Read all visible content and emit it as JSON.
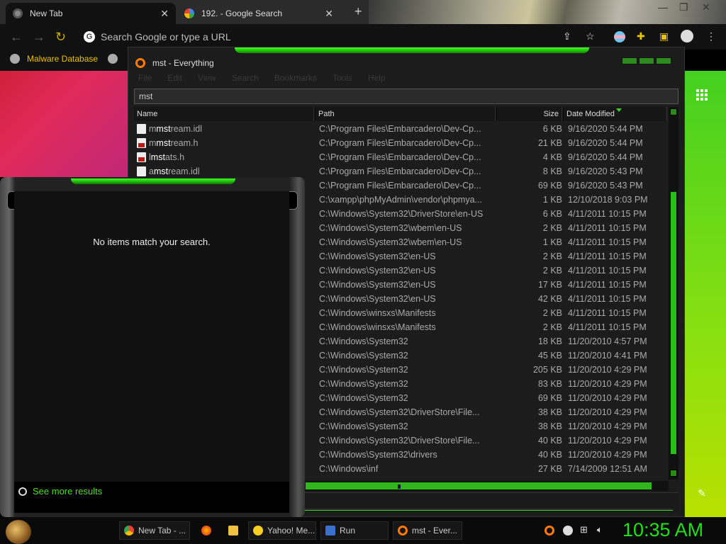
{
  "browser": {
    "tabs": [
      {
        "title": "New Tab",
        "active": true
      },
      {
        "title": "192. - Google Search",
        "active": false
      }
    ],
    "omnibox_placeholder": "Search Google or type a URL",
    "bookmark": "Malware Database"
  },
  "everything": {
    "title": "mst - Everything",
    "menu": [
      "File",
      "Edit",
      "View",
      "Search",
      "Bookmarks",
      "Tools",
      "Help"
    ],
    "search_value": "mst",
    "columns": {
      "name": "Name",
      "path": "Path",
      "size": "Size",
      "date": "Date Modified"
    },
    "rows": [
      {
        "pre": "m",
        "hit": "mst",
        "post": "ream.idl",
        "icon": "file",
        "path": "C:\\Program Files\\Embarcadero\\Dev-Cp...",
        "size": "6 KB",
        "date": "9/16/2020 5:44 PM"
      },
      {
        "pre": "m",
        "hit": "mst",
        "post": "ream.h",
        "icon": "red",
        "path": "C:\\Program Files\\Embarcadero\\Dev-Cp...",
        "size": "21 KB",
        "date": "9/16/2020 5:44 PM"
      },
      {
        "pre": "l",
        "hit": "mst",
        "post": "ats.h",
        "icon": "red",
        "path": "C:\\Program Files\\Embarcadero\\Dev-Cp...",
        "size": "4 KB",
        "date": "9/16/2020 5:44 PM"
      },
      {
        "pre": "a",
        "hit": "mst",
        "post": "ream.idl",
        "icon": "file",
        "path": "C:\\Program Files\\Embarcadero\\Dev-Cp...",
        "size": "8 KB",
        "date": "9/16/2020 5:43 PM"
      },
      {
        "pre": "",
        "hit": "",
        "post": "",
        "icon": "",
        "path": "C:\\Program Files\\Embarcadero\\Dev-Cp...",
        "size": "69 KB",
        "date": "9/16/2020 5:43 PM"
      },
      {
        "pre": "",
        "hit": "",
        "post": "",
        "icon": "",
        "path": "C:\\xampp\\phpMyAdmin\\vendor\\phpmya...",
        "size": "1 KB",
        "date": "12/10/2018 9:03 PM"
      },
      {
        "pre": "",
        "hit": "",
        "post": "",
        "icon": "",
        "path": "C:\\Windows\\System32\\DriverStore\\en-US",
        "size": "6 KB",
        "date": "4/11/2011 10:15 PM"
      },
      {
        "pre": "",
        "hit": "",
        "post": "",
        "icon": "",
        "path": "C:\\Windows\\System32\\wbem\\en-US",
        "size": "2 KB",
        "date": "4/11/2011 10:15 PM"
      },
      {
        "pre": "",
        "hit": "",
        "post": "",
        "icon": "",
        "path": "C:\\Windows\\System32\\wbem\\en-US",
        "size": "1 KB",
        "date": "4/11/2011 10:15 PM"
      },
      {
        "pre": "",
        "hit": "",
        "post": "",
        "icon": "",
        "path": "C:\\Windows\\System32\\en-US",
        "size": "2 KB",
        "date": "4/11/2011 10:15 PM"
      },
      {
        "pre": "",
        "hit": "",
        "post": "",
        "icon": "",
        "path": "C:\\Windows\\System32\\en-US",
        "size": "2 KB",
        "date": "4/11/2011 10:15 PM"
      },
      {
        "pre": "",
        "hit": "",
        "post": "",
        "icon": "",
        "path": "C:\\Windows\\System32\\en-US",
        "size": "17 KB",
        "date": "4/11/2011 10:15 PM"
      },
      {
        "pre": "",
        "hit": "",
        "post": "",
        "icon": "",
        "path": "C:\\Windows\\System32\\en-US",
        "size": "42 KB",
        "date": "4/11/2011 10:15 PM"
      },
      {
        "pre": "",
        "hit": "",
        "post": "",
        "icon": "",
        "path": "C:\\Windows\\winsxs\\Manifests",
        "size": "2 KB",
        "date": "4/11/2011 10:15 PM"
      },
      {
        "pre": "",
        "hit": "",
        "post": "",
        "icon": "",
        "path": "C:\\Windows\\winsxs\\Manifests",
        "size": "2 KB",
        "date": "4/11/2011 10:15 PM"
      },
      {
        "pre": "",
        "hit": "",
        "post": "",
        "icon": "",
        "path": "C:\\Windows\\System32",
        "size": "18 KB",
        "date": "11/20/2010 4:57 PM"
      },
      {
        "pre": "",
        "hit": "",
        "post": "",
        "icon": "",
        "path": "C:\\Windows\\System32",
        "size": "45 KB",
        "date": "11/20/2010 4:41 PM"
      },
      {
        "pre": "",
        "hit": "",
        "post": "",
        "icon": "",
        "path": "C:\\Windows\\System32",
        "size": "205 KB",
        "date": "11/20/2010 4:29 PM"
      },
      {
        "pre": "",
        "hit": "",
        "post": "",
        "icon": "",
        "path": "C:\\Windows\\System32",
        "size": "83 KB",
        "date": "11/20/2010 4:29 PM"
      },
      {
        "pre": "",
        "hit": "",
        "post": "",
        "icon": "",
        "path": "C:\\Windows\\System32",
        "size": "69 KB",
        "date": "11/20/2010 4:29 PM"
      },
      {
        "pre": "",
        "hit": "",
        "post": "",
        "icon": "",
        "path": "C:\\Windows\\System32\\DriverStore\\File...",
        "size": "38 KB",
        "date": "11/20/2010 4:29 PM"
      },
      {
        "pre": "",
        "hit": "",
        "post": "",
        "icon": "",
        "path": "C:\\Windows\\System32",
        "size": "38 KB",
        "date": "11/20/2010 4:29 PM"
      },
      {
        "pre": "",
        "hit": "",
        "post": "",
        "icon": "",
        "path": "C:\\Windows\\System32\\DriverStore\\File...",
        "size": "40 KB",
        "date": "11/20/2010 4:29 PM"
      },
      {
        "pre": "",
        "hit": "",
        "post": "",
        "icon": "",
        "path": "C:\\Windows\\System32\\drivers",
        "size": "40 KB",
        "date": "11/20/2010 4:29 PM"
      },
      {
        "pre": "",
        "hit": "",
        "post": "",
        "icon": "",
        "path": "C:\\Windows\\inf",
        "size": "27 KB",
        "date": "7/14/2009 12:51 AM"
      }
    ]
  },
  "popup": {
    "message": "No items match your search.",
    "more": "See more results"
  },
  "taskbar": {
    "items": [
      "New Tab - ...",
      "Yahoo! Me...",
      "Run",
      "mst - Ever..."
    ],
    "clock": "10:35 AM"
  },
  "colors": {
    "accent_green": "#3cd020",
    "clock_green": "#22e016",
    "bookmark_yellow": "#e9c200",
    "everything_orange": "#ff7a00"
  }
}
